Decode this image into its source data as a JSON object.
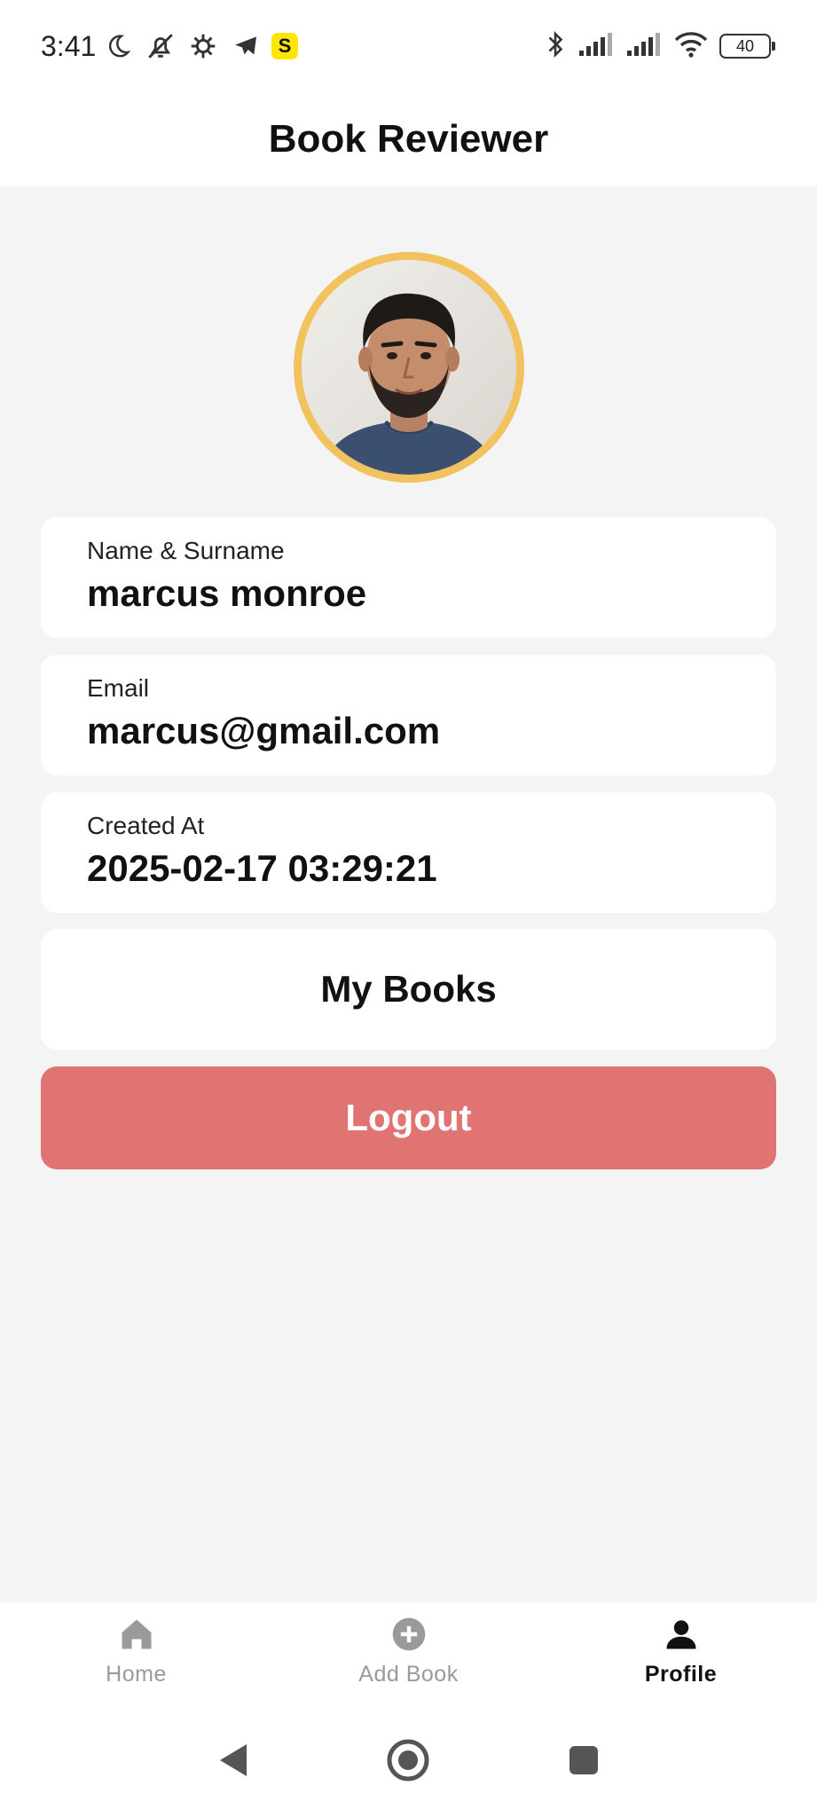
{
  "status_bar": {
    "time": "3:41",
    "battery": "40",
    "icons": [
      "moon-icon",
      "bell-off-icon",
      "settings-gear-icon",
      "telegram-icon",
      "s-app-icon",
      "bluetooth-icon",
      "signal-icon",
      "signal-icon",
      "wifi-icon",
      "battery-icon"
    ],
    "badge_s": "S"
  },
  "header": {
    "title": "Book Reviewer"
  },
  "profile": {
    "avatar_icon": "profile-photo",
    "accent_ring_color": "#f2c25e",
    "fields": [
      {
        "label": "Name & Surname",
        "value": "marcus monroe"
      },
      {
        "label": "Email",
        "value": "marcus@gmail.com"
      },
      {
        "label": "Created At",
        "value": "2025-02-17 03:29:21"
      }
    ],
    "my_books_label": "My Books",
    "logout_label": "Logout",
    "logout_color": "#df7473"
  },
  "bottom_nav": {
    "items": [
      {
        "label": "Home",
        "icon": "home-icon",
        "active": false
      },
      {
        "label": "Add Book",
        "icon": "add-circle-icon",
        "active": false
      },
      {
        "label": "Profile",
        "icon": "person-icon",
        "active": true
      }
    ]
  },
  "system_nav": {
    "icons": [
      "back-icon",
      "home-circle-icon",
      "recents-icon"
    ]
  }
}
